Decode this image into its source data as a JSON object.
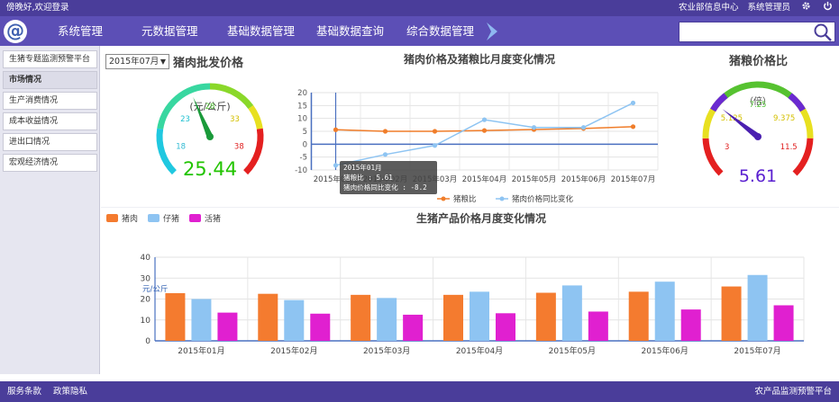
{
  "topbar": {
    "greeting": "傍晚好,欢迎登录",
    "links": [
      "农业部信息中心",
      "系统管理员"
    ],
    "icons": [
      "gear-icon",
      "power-icon"
    ]
  },
  "nav": {
    "logo": "@",
    "items": [
      "系统管理",
      "元数据管理",
      "基础数据管理",
      "基础数据查询",
      "综合数据管理"
    ],
    "search_placeholder": ""
  },
  "sidebar": {
    "items": [
      "生猪专题监测预警平台",
      "市场情况",
      "生产消费情况",
      "成本收益情况",
      "进出口情况",
      "宏观经济情况"
    ],
    "active_index": 1
  },
  "filter": {
    "month": "2015年07月"
  },
  "gauge_price": {
    "title": "猪肉批发价格",
    "unit": "(元/公斤)",
    "ticks": [
      "18",
      "23",
      "28",
      "33",
      "38"
    ],
    "min": 13,
    "max": 43,
    "value": 25.44,
    "value_label": "25.44",
    "colors": {
      "value_text": "#22c400"
    }
  },
  "gauge_ratio": {
    "title": "猪粮价格比",
    "unit": "（倍）",
    "ticks": [
      "3",
      "5.125",
      "7.25",
      "9.375",
      "11.5"
    ],
    "min": 3,
    "max": 11.5,
    "value": 5.61,
    "value_label": "5.61",
    "colors": {
      "value_text": "#5a1fd0"
    }
  },
  "line_chart_title": "猪肉价格及猪粮比月度变化情况",
  "bar_chart_title": "生猪产品价格月度变化情况",
  "tooltip": {
    "lines": [
      "2015年01月",
      "猪粮比 : 5.61",
      "猪肉价格同比变化 : -8.2"
    ]
  },
  "chart_data": [
    {
      "type": "line",
      "title": "猪肉价格及猪粮比月度变化情况",
      "categories": [
        "2015年01月",
        "2015年02月",
        "2015年03月",
        "2015年04月",
        "2015年05月",
        "2015年06月",
        "2015年07月"
      ],
      "yticks": [
        20,
        15,
        10,
        5,
        0,
        -5,
        -10
      ],
      "ylim": [
        -10,
        20
      ],
      "series": [
        {
          "name": "猪粮比",
          "color": "#f07d2a",
          "values": [
            5.61,
            5.0,
            5.0,
            5.3,
            5.7,
            6.1,
            6.8
          ]
        },
        {
          "name": "猪肉价格同比变化",
          "color": "#8ec4f2",
          "values": [
            -8.2,
            -4.0,
            -0.5,
            9.5,
            6.5,
            6.5,
            16.0
          ]
        }
      ],
      "legend_position": "bottom"
    },
    {
      "type": "bar",
      "title": "生猪产品价格月度变化情况",
      "ylabel": "元/公斤",
      "categories": [
        "2015年01月",
        "2015年02月",
        "2015年03月",
        "2015年04月",
        "2015年05月",
        "2015年06月",
        "2015年07月"
      ],
      "yticks": [
        40,
        30,
        20,
        10,
        0
      ],
      "ylim": [
        0,
        40
      ],
      "series": [
        {
          "name": "猪肉",
          "color": "#f47b2f",
          "values": [
            22.8,
            22.5,
            22.0,
            22.0,
            23.0,
            23.5,
            26.0
          ]
        },
        {
          "name": "仔猪",
          "color": "#8ec4f2",
          "values": [
            20.0,
            19.5,
            20.5,
            23.5,
            26.5,
            28.3,
            31.5
          ]
        },
        {
          "name": "活猪",
          "color": "#e020d0",
          "values": [
            13.5,
            13.0,
            12.5,
            13.2,
            14.0,
            15.0,
            17.0
          ]
        }
      ],
      "legend_position": "top-left"
    }
  ],
  "footer": {
    "links": [
      "服务条款",
      "政策隐私"
    ],
    "right": "农产品监测预警平台"
  }
}
